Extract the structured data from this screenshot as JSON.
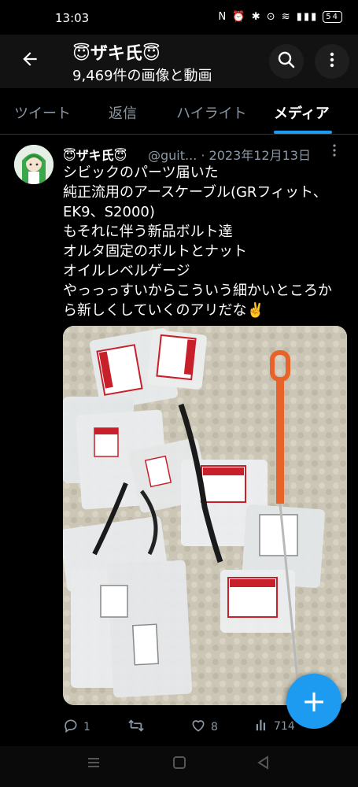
{
  "status_bar": {
    "time": "13:03",
    "icons": "N ⏰ ✱ ⊙ ≋ ▮▮▮",
    "battery": "54"
  },
  "header": {
    "title": "😇ザキ氏😇",
    "subtitle": "9,469件の画像と動画",
    "back_icon": "back-arrow-icon",
    "search_icon": "search-icon",
    "more_icon": "more-vertical-icon"
  },
  "tabs": [
    {
      "label": "ツイート",
      "active": false
    },
    {
      "label": "返信",
      "active": false
    },
    {
      "label": "ハイライト",
      "active": false
    },
    {
      "label": "メディア",
      "active": true
    }
  ],
  "tweet": {
    "author_name": "😇ザキ氏😇",
    "handle_date": "@guit... · 2023年12月13日",
    "lines": [
      "シビックのパーツ届いた",
      "純正流用のアースケーブル(GRフィット、",
      "EK9、S2000)",
      "もそれに伴う新品ボルト達",
      "オルタ固定のボルトとナット",
      "オイルレベルゲージ",
      "やっっっすいからこういう細かいところか",
      "ら新しくしていくのアリだな✌️"
    ],
    "actions": {
      "replies": "1",
      "retweets": "",
      "likes": "8",
      "views": "714"
    }
  },
  "fab_label": "+",
  "colors": {
    "accent": "#1d9bf0",
    "background": "#000000",
    "muted_text": "#8b98a5",
    "honda_red": "#c8202a",
    "dipstick_orange": "#e8632a"
  }
}
